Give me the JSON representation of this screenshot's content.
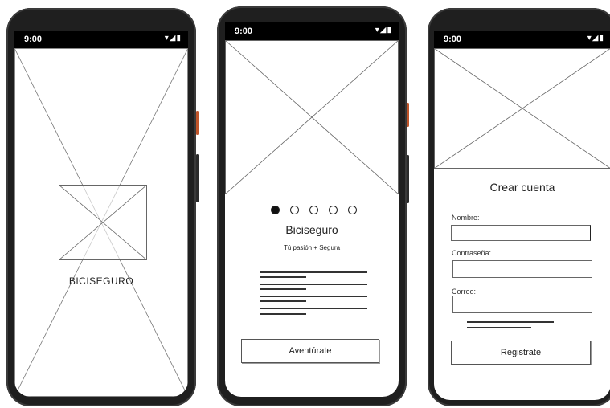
{
  "status_bar": {
    "time": "9:00",
    "icons": "▾◢▮"
  },
  "screen1": {
    "brand_text": "BICISEGURO"
  },
  "screen2": {
    "title": "Biciseguro",
    "subtitle": "Tú pasión + Segura",
    "pager": {
      "count": 5,
      "active_index": 0
    },
    "button_label": "Aventúrate"
  },
  "screen3": {
    "title": "Crear cuenta",
    "fields": [
      {
        "label": "Nombre:"
      },
      {
        "label": "Contraseña:"
      },
      {
        "label": "Correo:"
      }
    ],
    "button_label": "Registrate"
  }
}
